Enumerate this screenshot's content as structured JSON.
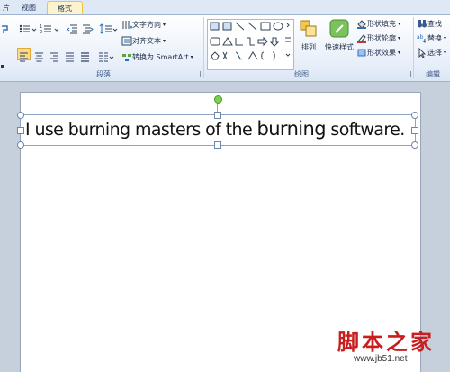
{
  "tabs": {
    "partial": "片",
    "view": "视图",
    "format": "格式"
  },
  "paragraph": {
    "text_direction": "文字方向",
    "align_text": "对齐文本",
    "convert_smartart": "转换为 SmartArt",
    "group_label": "段落"
  },
  "drawing": {
    "arrange": "排列",
    "quick_styles": "快速样式",
    "shape_fill": "形状填充",
    "shape_outline": "形状轮廓",
    "shape_effects": "形状效果",
    "group_label": "绘图"
  },
  "editing": {
    "find": "查找",
    "replace": "替换",
    "select": "选择",
    "group_label": "编辑"
  },
  "slide": {
    "text_part1": "I use burning masters of the ",
    "text_big": "burning",
    "text_part2": " software."
  },
  "watermark": {
    "name": "脚本之家",
    "url": "www.jb51.net"
  }
}
